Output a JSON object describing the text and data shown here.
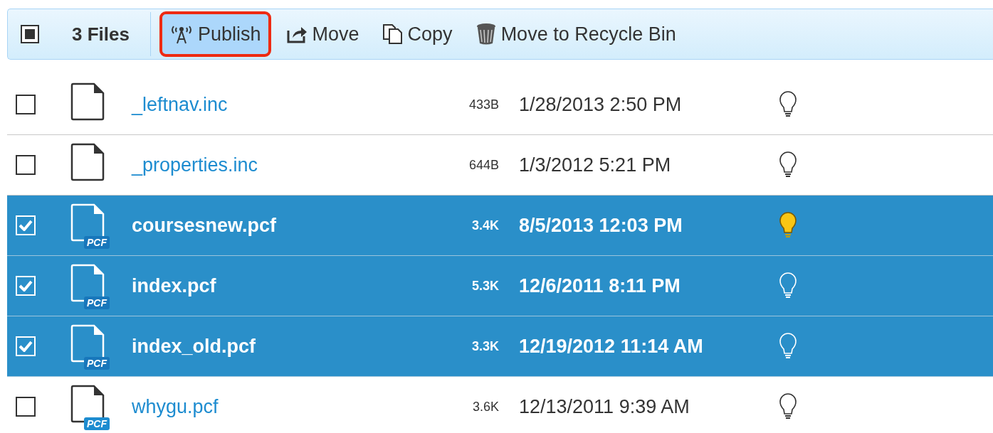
{
  "toolbar": {
    "select_all": {
      "mixed": true
    },
    "count": "3 Files",
    "actions": [
      {
        "kind": "publish",
        "label": "Publish",
        "highlighted": true
      },
      {
        "kind": "move",
        "label": "Move",
        "highlighted": false
      },
      {
        "kind": "copy",
        "label": "Copy",
        "highlighted": false
      },
      {
        "kind": "recycle",
        "label": "Move to Recycle Bin",
        "highlighted": false
      }
    ]
  },
  "files": [
    {
      "name": "_leftnav.inc",
      "kind": "inc",
      "size": "433B",
      "modified": "1/28/2013 2:50 PM",
      "checked": false,
      "selected": false,
      "on": false
    },
    {
      "name": "_properties.inc",
      "kind": "inc",
      "size": "644B",
      "modified": "1/3/2012 5:21 PM",
      "checked": false,
      "selected": false,
      "on": false
    },
    {
      "name": "coursesnew.pcf",
      "kind": "pcf",
      "badge": "PCF",
      "size": "3.4K",
      "modified": "8/5/2013 12:03 PM",
      "checked": true,
      "selected": true,
      "on": true
    },
    {
      "name": "index.pcf",
      "kind": "pcf",
      "badge": "PCF",
      "size": "5.3K",
      "modified": "12/6/2011 8:11 PM",
      "checked": true,
      "selected": true,
      "on": false
    },
    {
      "name": "index_old.pcf",
      "kind": "pcf",
      "badge": "PCF",
      "size": "3.3K",
      "modified": "12/19/2012 11:14 AM",
      "checked": true,
      "selected": true,
      "on": false
    },
    {
      "name": "whygu.pcf",
      "kind": "pcf",
      "badge": "PCF",
      "size": "3.6K",
      "modified": "12/13/2011 9:39 AM",
      "checked": false,
      "selected": false,
      "on": false
    }
  ]
}
